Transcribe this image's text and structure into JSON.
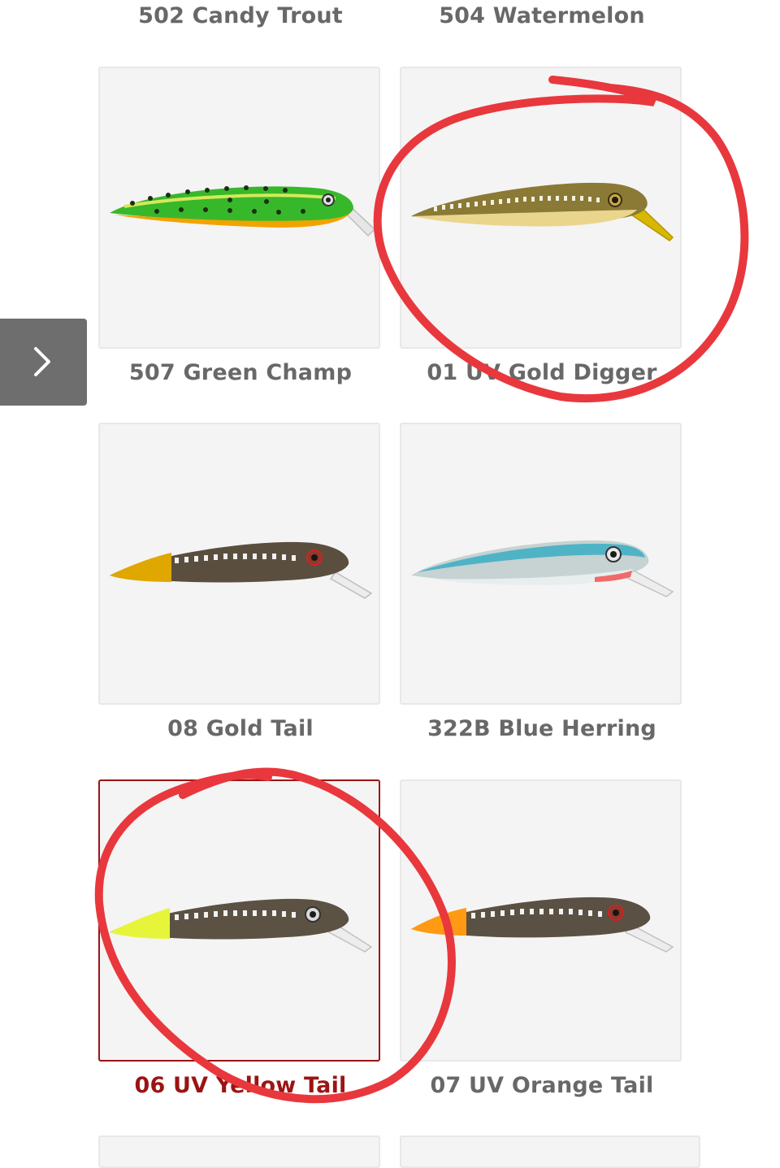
{
  "products": [
    {
      "label": "502 Candy Trout",
      "selected": false
    },
    {
      "label": "504 Watermelon",
      "selected": false
    },
    {
      "label": "507 Green Champ",
      "selected": false,
      "icon": "lure-green-champ-icon"
    },
    {
      "label": "01 UV Gold Digger",
      "selected": false,
      "icon": "lure-gold-digger-icon"
    },
    {
      "label": "08 Gold Tail",
      "selected": false,
      "icon": "lure-gold-tail-icon"
    },
    {
      "label": "322B Blue Herring",
      "selected": false,
      "icon": "lure-blue-herring-icon"
    },
    {
      "label": "06 UV Yellow Tail",
      "selected": true,
      "icon": "lure-yellow-tail-icon"
    },
    {
      "label": "07 UV Orange Tail",
      "selected": false,
      "icon": "lure-orange-tail-icon"
    }
  ],
  "nav": {
    "next_icon": "chevron-right-icon"
  },
  "colors": {
    "accent": "#9b1414",
    "annotation": "#e8383d",
    "label": "#686868",
    "tile_bg": "#f4f4f4"
  }
}
